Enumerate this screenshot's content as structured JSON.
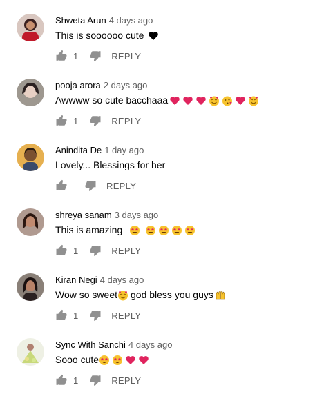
{
  "comments": [
    {
      "author": "Shweta Arun",
      "time": "4 days ago",
      "text": "This is soooooo cute",
      "trailing_emojis": [
        "black-heart"
      ],
      "likes": "1",
      "reply_label": "REPLY",
      "avatar_color": "#2b1a1a"
    },
    {
      "author": "pooja arora",
      "time": "2 days ago",
      "text": "Awwww so cute bacchaaa",
      "trailing_emojis": [
        "red-heart",
        "red-heart",
        "red-heart",
        "smiling-face-with-hearts",
        "face-blowing-kiss",
        "red-heart",
        "smiling-face-with-hearts"
      ],
      "likes": "1",
      "reply_label": "REPLY",
      "avatar_color": "#6b6660"
    },
    {
      "author": "Anindita De",
      "time": "1 day ago",
      "text": "Lovely... Blessings for her",
      "trailing_emojis": [],
      "likes": "",
      "reply_label": "REPLY",
      "avatar_color": "#c98a3a"
    },
    {
      "author": "shreya sanam",
      "time": "3 days ago",
      "text": "This is amazing",
      "trailing_emojis": [
        "star-struck",
        "star-struck",
        "star-struck",
        "star-struck",
        "star-struck"
      ],
      "likes": "1",
      "reply_label": "REPLY",
      "avatar_color": "#5a3d34"
    },
    {
      "author": "Kiran Negi",
      "time": "4 days ago",
      "text": "Wow so sweet",
      "text_after": "god bless you guys",
      "middle_emojis": [
        "smiling-face-with-hearts"
      ],
      "trailing_emojis": [
        "raising-hands"
      ],
      "likes": "1",
      "reply_label": "REPLY",
      "avatar_color": "#4a3a38"
    },
    {
      "author": "Sync With Sanchi",
      "time": "4 days ago",
      "text": "Sooo cute",
      "trailing_emojis": [
        "star-struck",
        "star-struck",
        "red-heart",
        "red-heart"
      ],
      "likes": "1",
      "reply_label": "REPLY",
      "avatar_color": "#d8e2c0"
    }
  ],
  "colors": {
    "text_primary": "#030303",
    "text_secondary": "#606060",
    "heart_red": "#e0245e",
    "emoji_yellow": "#f7c32e"
  }
}
